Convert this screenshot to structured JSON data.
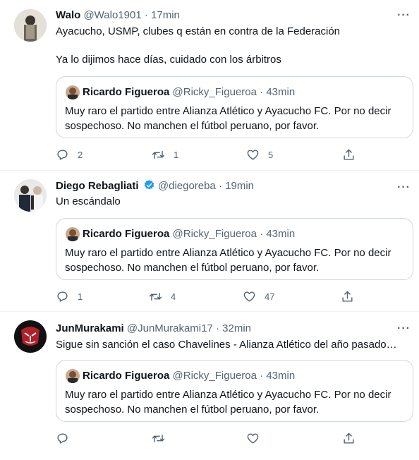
{
  "quoted_tweet": {
    "name": "Ricardo Figueroa",
    "handle": "@Ricky_Figueroa",
    "separator": "·",
    "time": "43min",
    "text": "Muy raro el partido entre Alianza Atlético y Ayacucho FC. Por no decir sospechoso. No manchen el fútbol peruano, por favor."
  },
  "tweets": [
    {
      "name": "Walo",
      "handle": "@Walo1901",
      "separator": "·",
      "time": "17min",
      "text": "Ayacucho, USMP, clubes q están en contra de la Federación\n\nYa lo dijimos hace días, cuidado con los árbitros",
      "replies": "2",
      "retweets": "1",
      "likes": "5",
      "menu": "···"
    },
    {
      "name": "Diego Rebagliati",
      "verified": true,
      "handle": "@diegoreba",
      "separator": "·",
      "time": "19min",
      "text": "Un escándalo",
      "replies": "1",
      "retweets": "4",
      "likes": "47",
      "menu": "···"
    },
    {
      "name": "JunMurakami",
      "handle": "@JunMurakami17",
      "separator": "·",
      "time": "32min",
      "text": "Sigue sin sanción el caso Chavelines - Alianza Atlético del año pasado…",
      "replies": "",
      "retweets": "",
      "likes": "",
      "menu": "···"
    }
  ],
  "icons": {
    "reply": "reply-icon",
    "retweet": "retweet-icon",
    "like": "heart-icon",
    "share": "share-icon",
    "verified": "verified-badge-icon"
  },
  "colors": {
    "text": "#0f1419",
    "secondary": "#536471",
    "border": "#cfd9de",
    "verified": "#1d9bf0"
  }
}
